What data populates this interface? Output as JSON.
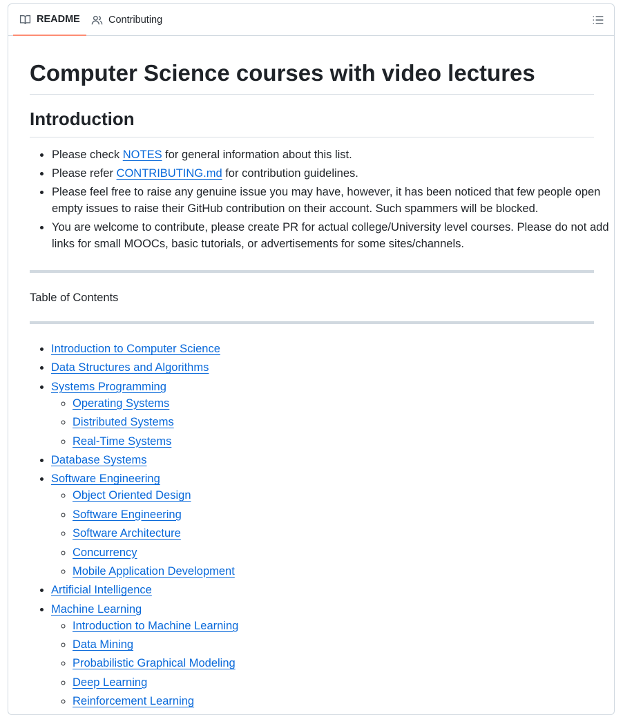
{
  "tabs": {
    "readme_label": "README",
    "contributing_label": "Contributing"
  },
  "heading": "Computer Science courses with video lectures",
  "intro": {
    "title": "Introduction",
    "item1_pre": "Please check ",
    "item1_link": "NOTES",
    "item1_post": " for general information about this list.",
    "item2_pre": "Please refer ",
    "item2_link": "CONTRIBUTING.md",
    "item2_post": " for contribution guidelines.",
    "item3": "Please feel free to raise any genuine issue you may have, however, it has been noticed that few people open empty issues to raise their GitHub contribution on their account. Such spammers will be blocked.",
    "item4": "You are welcome to contribute, please create PR for actual college/University level courses. Please do not add links for small MOOCs, basic tutorials, or advertisements for some sites/channels."
  },
  "toc": {
    "title": "Table of Contents",
    "items": [
      {
        "label": "Introduction to Computer Science",
        "children": []
      },
      {
        "label": "Data Structures and Algorithms",
        "children": []
      },
      {
        "label": "Systems Programming",
        "children": [
          "Operating Systems",
          "Distributed Systems",
          "Real-Time Systems"
        ]
      },
      {
        "label": "Database Systems",
        "children": []
      },
      {
        "label": "Software Engineering",
        "children": [
          "Object Oriented Design",
          "Software Engineering",
          "Software Architecture",
          "Concurrency",
          "Mobile Application Development"
        ]
      },
      {
        "label": "Artificial Intelligence",
        "children": []
      },
      {
        "label": "Machine Learning",
        "children": [
          "Introduction to Machine Learning",
          "Data Mining",
          "Probabilistic Graphical Modeling",
          "Deep Learning",
          "Reinforcement Learning"
        ]
      }
    ]
  },
  "colors": {
    "link": "#0969da",
    "text": "#1f2328",
    "tab_underline": "#fd8c73",
    "border": "#d1d9e0"
  },
  "icons": {
    "readme": "book-icon",
    "contributing": "people-icon",
    "outline": "list-unordered-icon"
  }
}
